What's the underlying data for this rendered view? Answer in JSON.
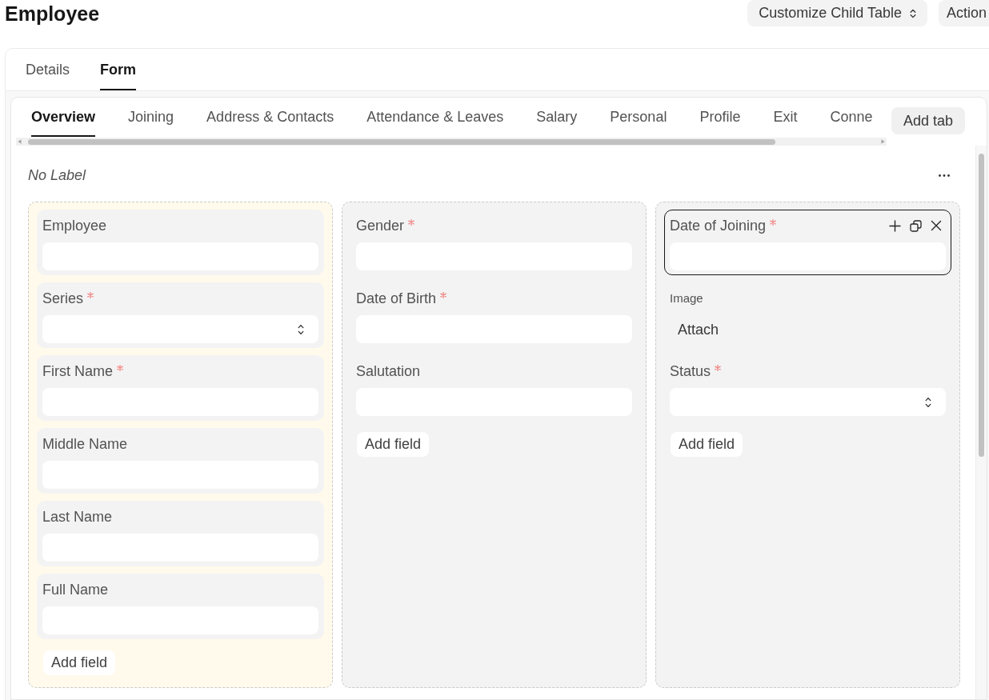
{
  "page_title": "Employee",
  "header_buttons": [
    {
      "label": "Customize Child Table",
      "kind": "dropdown"
    },
    {
      "label": "Action",
      "kind": "plain"
    }
  ],
  "view_tabs": [
    {
      "label": "Details",
      "selected": false
    },
    {
      "label": "Form",
      "selected": true
    }
  ],
  "form_tabs": [
    {
      "label": "Overview",
      "selected": true
    },
    {
      "label": "Joining",
      "selected": false
    },
    {
      "label": "Address & Contacts",
      "selected": false
    },
    {
      "label": "Attendance & Leaves",
      "selected": false
    },
    {
      "label": "Salary",
      "selected": false
    },
    {
      "label": "Personal",
      "selected": false
    },
    {
      "label": "Profile",
      "selected": false
    },
    {
      "label": "Exit",
      "selected": false
    },
    {
      "label": "Conne",
      "selected": false
    }
  ],
  "add_tab_button": "Add tab",
  "section": {
    "label": "No Label",
    "columns": [
      {
        "selected": true,
        "fields": [
          {
            "label": "Employee",
            "kind": "input",
            "required": false,
            "selected": false
          },
          {
            "label": "Series",
            "kind": "select",
            "required": true,
            "selected": false
          },
          {
            "label": "First Name",
            "kind": "input",
            "required": true,
            "selected": false
          },
          {
            "label": "Middle Name",
            "kind": "input",
            "required": false,
            "selected": false
          },
          {
            "label": "Last Name",
            "kind": "input",
            "required": false,
            "selected": false
          },
          {
            "label": "Full Name",
            "kind": "input",
            "required": false,
            "selected": false
          }
        ],
        "add_field_button": "Add field"
      },
      {
        "selected": false,
        "fields": [
          {
            "label": "Gender",
            "kind": "input",
            "required": true,
            "selected": false
          },
          {
            "label": "Date of Birth",
            "kind": "input",
            "required": true,
            "selected": false
          },
          {
            "label": "Salutation",
            "kind": "input",
            "required": false,
            "selected": false
          }
        ],
        "add_field_button": "Add field"
      },
      {
        "selected": false,
        "fields": [
          {
            "label": "Date of Joining",
            "kind": "input",
            "required": true,
            "selected": true
          },
          {
            "label": "Image",
            "kind": "attach",
            "required": false,
            "selected": false,
            "button": "Attach"
          },
          {
            "label": "Status",
            "kind": "select",
            "required": true,
            "selected": false
          }
        ],
        "add_field_button": "Add field"
      }
    ]
  }
}
